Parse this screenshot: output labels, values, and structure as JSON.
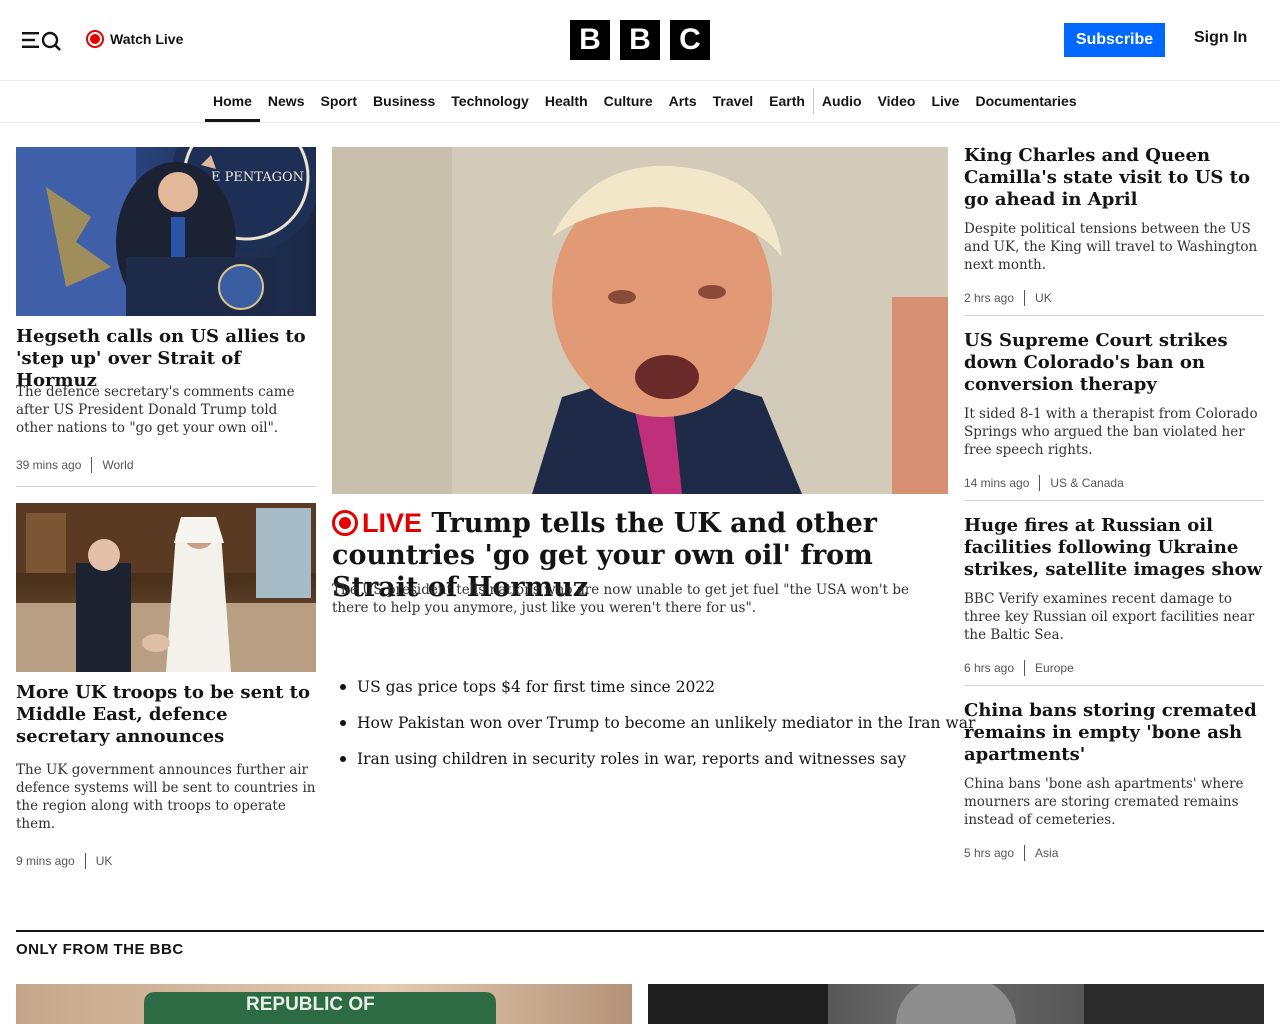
{
  "header": {
    "watch_live": "Watch Live",
    "logo_letters": [
      "B",
      "B",
      "C"
    ],
    "subscribe": "Subscribe",
    "sign_in": "Sign In"
  },
  "nav": {
    "items": [
      "Home",
      "News",
      "Sport",
      "Business",
      "Technology",
      "Health",
      "Culture",
      "Arts",
      "Travel",
      "Earth",
      "Audio",
      "Video",
      "Live",
      "Documentaries"
    ],
    "active": "Home"
  },
  "left": {
    "story1": {
      "headline": "Hegseth calls on US allies to 'step up' over Strait of Hormuz",
      "summary": "The defence secretary's comments came after US President Donald Trump told other nations to \"go get your own oil\".",
      "time": "39 mins ago",
      "category": "World",
      "image_text": "E PENTAGON"
    },
    "story2": {
      "headline": "More UK troops to be sent to Middle East, defence secretary announces",
      "summary": "The UK government announces further air defence systems will be sent to countries in the region along with troops to operate them.",
      "time": "9 mins ago",
      "category": "UK"
    }
  },
  "center": {
    "live_label": "LIVE",
    "headline": "Trump tells the UK and other countries 'go get your own oil' from Strait of Hormuz",
    "summary": "The US president tells nations who are now unable to get jet fuel \"the USA won't be there to help you anymore, just like you weren't there for us\".",
    "related": [
      "US gas price tops $4 for first time since 2022",
      "How Pakistan won over Trump to become an unlikely mediator in the Iran war",
      "Iran using children in security roles in war, reports and witnesses say"
    ]
  },
  "right": [
    {
      "headline": "King Charles and Queen Camilla's state visit to US to go ahead in April",
      "summary": "Despite political tensions between the US and UK, the King will travel to Washington next month.",
      "time": "2 hrs ago",
      "category": "UK"
    },
    {
      "headline": "US Supreme Court strikes down Colorado's ban on conversion therapy",
      "summary": "It sided 8-1 with a therapist from Colorado Springs who argued the ban violated her free speech rights.",
      "time": "14 mins ago",
      "category": "US & Canada"
    },
    {
      "headline": "Huge fires at Russian oil facilities following Ukraine strikes, satellite images show",
      "summary": "BBC Verify examines recent damage to three key Russian oil export facilities near the Baltic Sea.",
      "time": "6 hrs ago",
      "category": "Europe"
    },
    {
      "headline": "China bans storing cremated remains in empty 'bone ash apartments'",
      "summary": "China bans 'bone ash apartments' where mourners are storing cremated remains instead of cemeteries.",
      "time": "5 hrs ago",
      "category": "Asia"
    }
  ],
  "section": {
    "title": "ONLY FROM THE BBC",
    "card1_image_text": "REPUBLIC OF"
  },
  "colors": {
    "accent_blue": "#0068ff",
    "live_red": "#e50000",
    "text": "#141414"
  }
}
